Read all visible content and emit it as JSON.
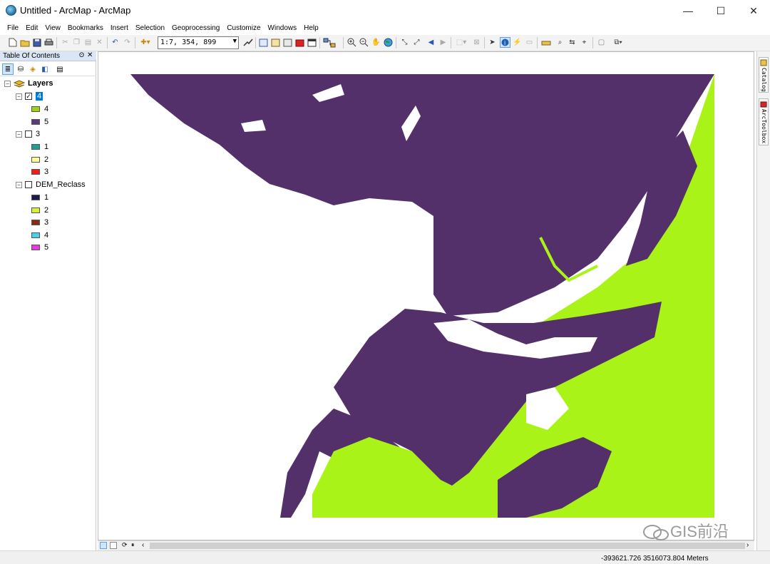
{
  "window": {
    "title": "Untitled - ArcMap - ArcMap",
    "minimize": "—",
    "maximize": "☐",
    "close": "✕"
  },
  "menu": [
    "File",
    "Edit",
    "View",
    "Bookmarks",
    "Insert",
    "Selection",
    "Geoprocessing",
    "Customize",
    "Windows",
    "Help"
  ],
  "toolbar": {
    "scale": "1:7, 354, 899",
    "scale_arrow": "▼"
  },
  "toc": {
    "title": "Table Of Contents",
    "pin": "ʘ",
    "close": "✕",
    "root_label": "Layers",
    "layers": [
      {
        "name": "4",
        "checked": true,
        "checkmark": "✓",
        "expander": "−",
        "classes": [
          {
            "label": "4",
            "color": "#9ed21a"
          },
          {
            "label": "5",
            "color": "#5a3a78"
          }
        ]
      },
      {
        "name": "3",
        "checked": false,
        "checkmark": "",
        "expander": "−",
        "classes": [
          {
            "label": "1",
            "color": "#1aa28e"
          },
          {
            "label": "2",
            "color": "#fefe90"
          },
          {
            "label": "3",
            "color": "#f21c1c"
          }
        ]
      },
      {
        "name": "DEM_Reclass",
        "checked": false,
        "checkmark": "",
        "expander": "−",
        "classes": [
          {
            "label": "1",
            "color": "#1c1c4c"
          },
          {
            "label": "2",
            "color": "#d8f03a"
          },
          {
            "label": "3",
            "color": "#8a2a14"
          },
          {
            "label": "4",
            "color": "#44d2e8"
          },
          {
            "label": "5",
            "color": "#e43ae0"
          }
        ]
      }
    ]
  },
  "map": {
    "class4_color": "#aaf318",
    "class5_color": "#54306b"
  },
  "side_tabs": [
    "Catalog",
    "ArcToolbox"
  ],
  "status": {
    "coords": "-393621.726  3516073.804 Meters"
  },
  "watermark": "GIS前沿"
}
